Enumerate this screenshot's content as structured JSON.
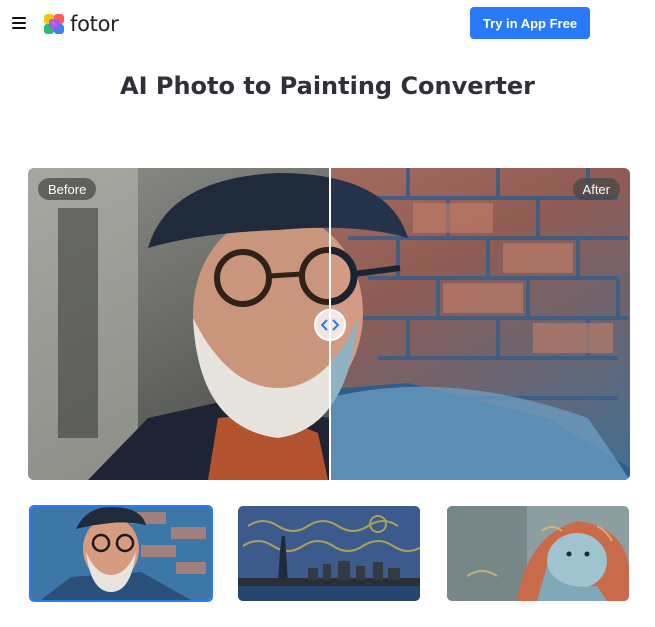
{
  "header": {
    "logo_text": "fotor",
    "cta_label": "Try in App Free"
  },
  "main": {
    "title": "AI Photo to Painting Converter"
  },
  "compare": {
    "before_label": "Before",
    "after_label": "After",
    "slider_position": 0.5
  },
  "thumbnails": [
    {
      "name": "portrait-man-painting",
      "selected": true
    },
    {
      "name": "statue-of-liberty-starry-night",
      "selected": false
    },
    {
      "name": "lion-painting",
      "selected": false
    }
  ],
  "icons": {
    "menu": "hamburger-icon",
    "logo": "fotor-logo-icon",
    "handle": "compare-arrows-icon"
  },
  "colors": {
    "accent": "#2a79f6",
    "title": "#2f3038",
    "tag_bg": "#464646"
  }
}
